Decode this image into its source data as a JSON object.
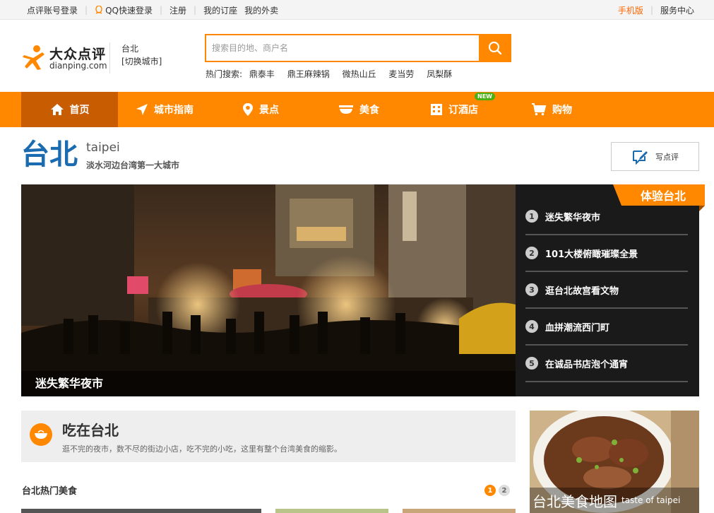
{
  "topbar": {
    "login": "点评账号登录",
    "qq_login": "QQ快速登录",
    "register": "注册",
    "my_booking": "我的订座",
    "my_takeout": "我的外卖",
    "mobile": "手机版",
    "service": "服务中心"
  },
  "header": {
    "logo_cn": "大众点评",
    "logo_en": "dianping.com",
    "city": "台北",
    "switch_city": "[切换城市]",
    "search_placeholder": "搜索目的地、商户名",
    "hot_label": "热门搜索:",
    "hot_terms": [
      "鼎泰丰",
      "鼎王麻辣锅",
      "微热山丘",
      "麦当劳",
      "凤梨酥"
    ]
  },
  "nav": {
    "items": [
      "首页",
      "城市指南",
      "景点",
      "美食",
      "订酒店",
      "购物"
    ],
    "new_badge": "NEW"
  },
  "city": {
    "name_cn": "台北",
    "name_en": "taipei",
    "slogan": "淡水河边台湾第一大城市",
    "write_review": "写点评"
  },
  "hero": {
    "caption": "迷失繁华夜市",
    "tag": "体验台北",
    "list": [
      {
        "num": "1",
        "text": "迷失繁华夜市"
      },
      {
        "num": "2",
        "text": "101大楼俯瞰璀璨全景"
      },
      {
        "num": "3",
        "text": "逛台北故宫看文物"
      },
      {
        "num": "4",
        "text": "血拼潮流西门町"
      },
      {
        "num": "5",
        "text": "在诚品书店泡个通宵"
      }
    ]
  },
  "eat": {
    "title": "吃在台北",
    "desc": "逛不完的夜市，数不尽的街边小店，吃不完的小吃，这里有整个台湾美食的缩影。",
    "hot_food": "台北热门美食",
    "pages": [
      "1",
      "2"
    ]
  },
  "food_map": {
    "cn": "台北美食地图",
    "en": "taste of taipei"
  },
  "colors": {
    "accent": "#ff8800",
    "active_nav": "#c75c00",
    "city_blue": "#1a6bb0"
  }
}
